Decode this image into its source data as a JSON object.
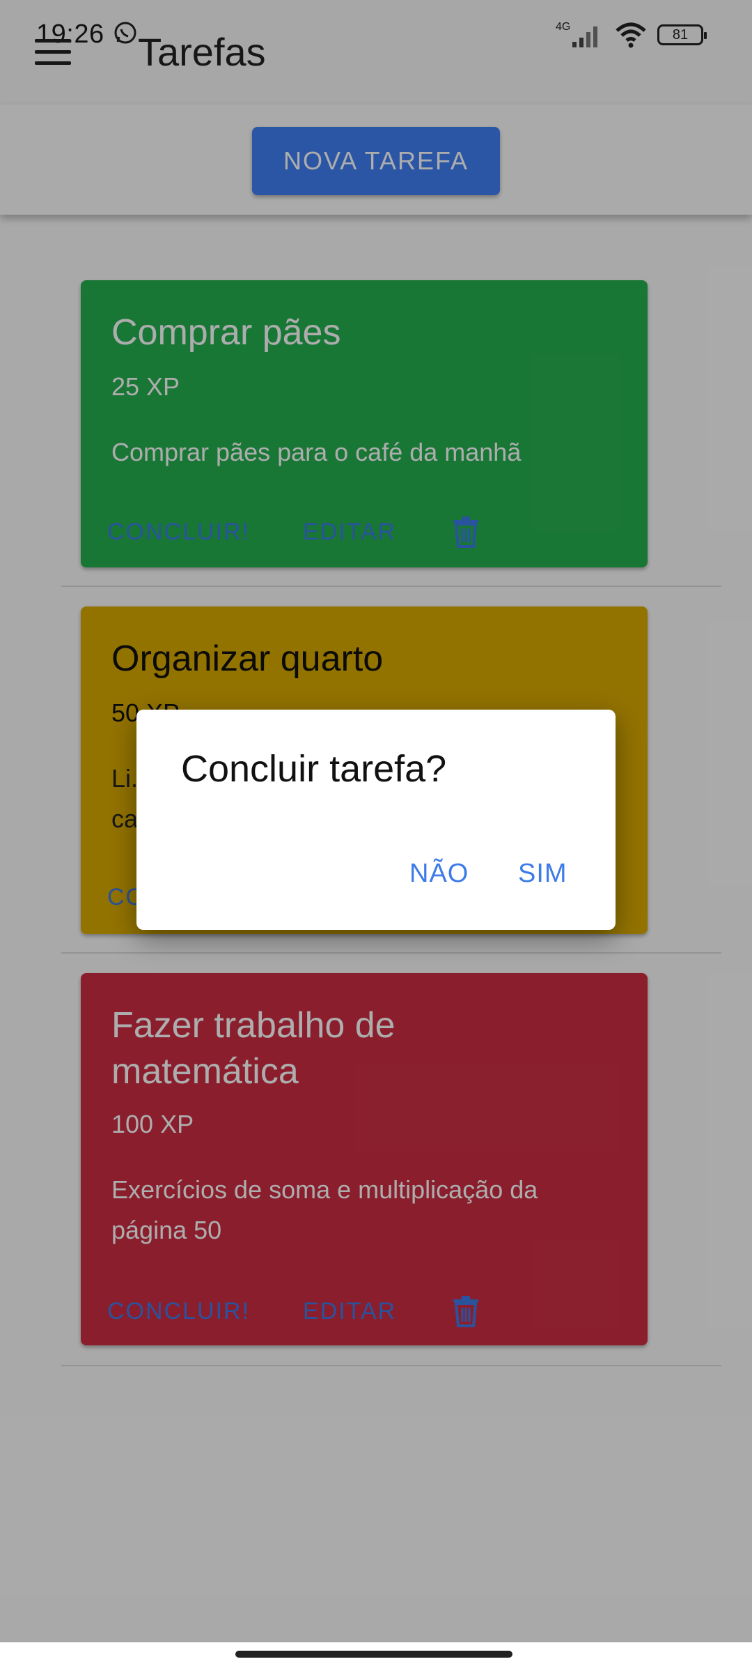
{
  "status_bar": {
    "time": "19:26",
    "network": "4G",
    "battery": "81"
  },
  "app_bar": {
    "title": "Tarefas"
  },
  "toolbar": {
    "new_task_label": "NOVA TAREFA"
  },
  "colors": {
    "green": "#26b050",
    "yellow": "#d9aa00",
    "red": "#cc2d43",
    "accent": "#3d7be8"
  },
  "tasks": [
    {
      "title": "Comprar pães",
      "xp": "25 XP",
      "description": "Comprar pães para o café da manhã",
      "complete_label": "CONCLUIR!",
      "edit_label": "EDITAR"
    },
    {
      "title": "Organizar quarto",
      "xp": "50 XP",
      "description": "Li...",
      "description_line2": "ca...",
      "complete_label": "CO"
    },
    {
      "title_line1": "Fazer trabalho de",
      "title_line2": "matemática",
      "xp": "100 XP",
      "description_line1": "Exercícios de soma e multiplicação da",
      "description_line2": "página 50",
      "complete_label": "CONCLUIR!",
      "edit_label": "EDITAR"
    }
  ],
  "dialog": {
    "title": "Concluir tarefa?",
    "no_label": "NÃO",
    "yes_label": "SIM"
  }
}
